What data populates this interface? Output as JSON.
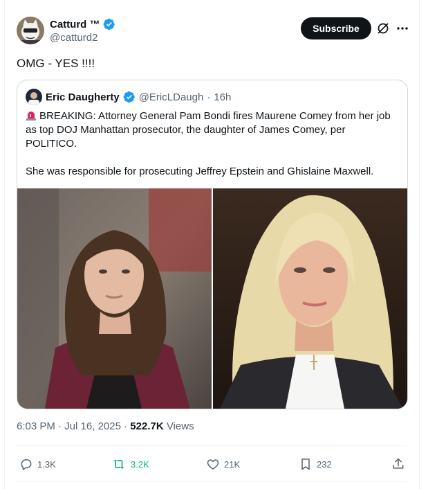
{
  "author": {
    "display_name": "Catturd ™",
    "handle": "@catturd2",
    "avatar_icon": "cartoon-cat-avatar"
  },
  "header": {
    "subscribe_label": "Subscribe",
    "grok_icon": "grok-icon",
    "more_icon": "more-icon"
  },
  "tweet": {
    "text": "OMG - YES !!!!"
  },
  "quote": {
    "display_name": "Eric Daugherty",
    "handle": "@EricLDaugh",
    "separator": "·",
    "age": "16h",
    "paragraph1": "BREAKING: Attorney General Pam Bondi fires Maurene Comey from her job as top DOJ Manhattan prosecutor, the daughter of James Comey, per POLITICO.",
    "paragraph2": "She was responsible for prosecuting Jeffrey Epstein and Ghislaine Maxwell.",
    "siren_icon": "rotating-light-emoji"
  },
  "meta": {
    "time": "6:03 PM",
    "separator": "·",
    "date": "Jul 16, 2025",
    "views_count": "522.7K",
    "views_label": "Views"
  },
  "actions": {
    "replies": "1.3K",
    "reposts": "3.2K",
    "likes": "21K",
    "bookmarks": "232"
  },
  "colors": {
    "accent": "#1d9bf0",
    "repost_active": "#00ba7c",
    "text_primary": "#0f1419",
    "text_secondary": "#536471",
    "border": "#cfd9de"
  }
}
